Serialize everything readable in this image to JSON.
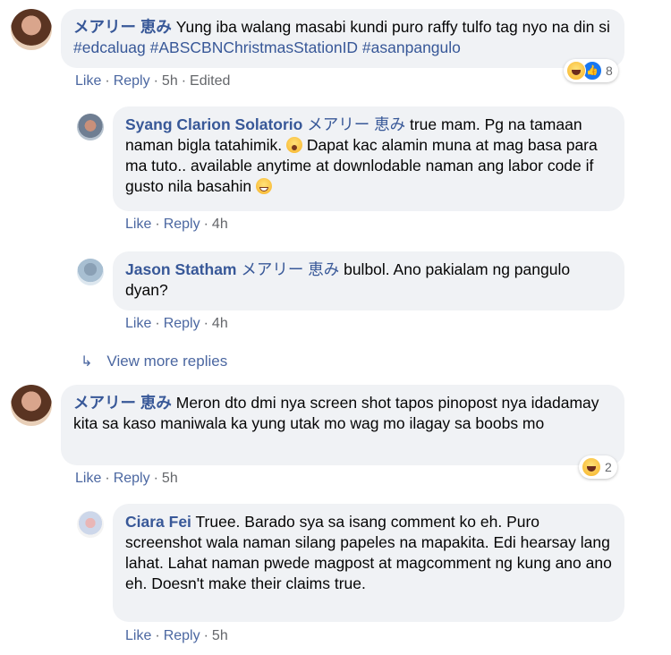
{
  "comment1": {
    "author": "メアリー 恵み",
    "text": "Yung iba walang masabi kundi puro raffy tulfo tag nyo na din si ",
    "hashtags": "#edcaluag #ABSCBNChristmasStationID #asanpangulo",
    "like": "Like",
    "reply": "Reply",
    "time": "5h",
    "edited": "Edited",
    "reaction_count": "8",
    "reaction_icons": [
      "haha-icon",
      "like-icon"
    ]
  },
  "reply1": {
    "author": "Syang Clarion Solatorio",
    "mention": "メアリー 恵み",
    "text1": " true mam. Pg na tamaan naman bigla tatahimik. ",
    "text2": " Dapat kac alamin muna at mag basa para ma tuto.. available anytime at downlodable naman ang labor code if gusto nila basahin ",
    "like": "Like",
    "reply": "Reply",
    "time": "4h"
  },
  "reply2": {
    "author": "Jason Statham",
    "mention": "メアリー 恵み",
    "text": " bulbol. Ano pakialam ng pangulo dyan?",
    "like": "Like",
    "reply": "Reply",
    "time": "4h"
  },
  "view_more": {
    "label": "View more replies"
  },
  "comment2": {
    "author": "メアリー 恵み",
    "text": " Meron dto dmi nya screen shot tapos pinopost nya idadamay kita sa kaso maniwala ka yung utak mo wag mo ilagay sa boobs mo",
    "like": "Like",
    "reply": "Reply",
    "time": "5h",
    "reaction_count": "2",
    "reaction_icons": [
      "haha-icon"
    ]
  },
  "reply3": {
    "author": "Ciara Fei",
    "text": " Truee. Barado sya sa isang comment ko eh. Puro screenshot wala naman silang papeles na mapakita. Edi hearsay lang lahat. Lahat naman pwede magpost at magcomment ng kung ano ano eh. Doesn't make their claims true.",
    "like": "Like",
    "reply": "Reply",
    "time": "5h"
  },
  "separator": "·"
}
